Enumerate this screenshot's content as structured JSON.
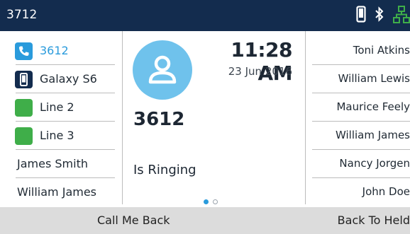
{
  "status_bar": {
    "extension": "3712",
    "icons": [
      "mobile-phone-icon",
      "bluetooth-icon",
      "network-icon"
    ]
  },
  "line_keys": [
    {
      "label": "3612",
      "icon": "phone-handset-icon",
      "color": "#2a9bdc",
      "label_color": "#2a9bdc"
    },
    {
      "label": "Galaxy S6",
      "icon": "mobile-phone-icon",
      "color": "#132c4e"
    },
    {
      "label": "Line 2",
      "icon": "line-status-icon",
      "color": "#3fae49"
    },
    {
      "label": "Line 3",
      "icon": "line-status-icon",
      "color": "#3fae49"
    },
    {
      "label": "James Smith"
    },
    {
      "label": "William James"
    }
  ],
  "call": {
    "time": "11:28 AM",
    "date": "23 Jun 2016",
    "number": "3612",
    "status": "Is Ringing",
    "avatar_color": "#6fc2ec",
    "page_count": 2,
    "active_page": 1
  },
  "contacts": [
    {
      "label": "Toni Atkins"
    },
    {
      "label": "William Lewis"
    },
    {
      "label": "Maurice Feely"
    },
    {
      "label": "William James"
    },
    {
      "label": "Nancy Jorgen"
    },
    {
      "label": "John Doe"
    }
  ],
  "softkeys": {
    "left": "Call Me Back",
    "right": "Back To Held"
  },
  "colors": {
    "status_bar": "#132c4e",
    "accent_blue": "#2a9bdc",
    "line_green": "#3fae49",
    "softkey_bar": "#dcdcdc"
  }
}
